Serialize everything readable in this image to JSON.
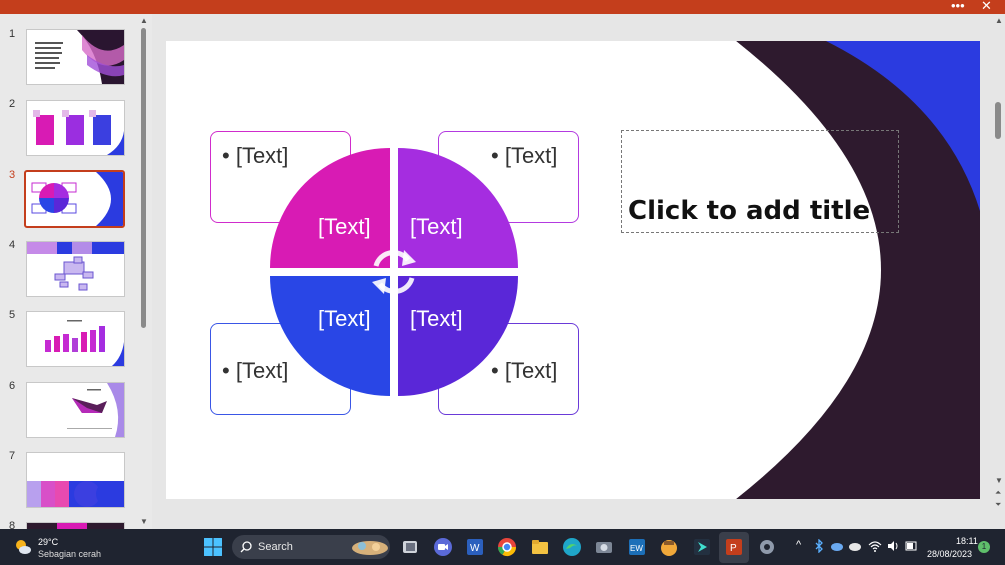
{
  "titlebar": {
    "more_glyph": "•••",
    "close_glyph": "✕"
  },
  "slides_panel": {
    "items": [
      {
        "num": "1"
      },
      {
        "num": "2"
      },
      {
        "num": "3"
      },
      {
        "num": "4"
      },
      {
        "num": "5"
      },
      {
        "num": "6"
      },
      {
        "num": "7"
      },
      {
        "num": "8"
      }
    ],
    "active_index": 3
  },
  "slide": {
    "title_placeholder": "Click to add title",
    "bullets": {
      "top_left": "[Text]",
      "top_right": "[Text]",
      "bottom_left": "[Text]",
      "bottom_right": "[Text]"
    },
    "quadrants": {
      "top_left": "[Text]",
      "top_right": "[Text]",
      "bottom_left": "[Text]",
      "bottom_right": "[Text]"
    }
  },
  "colors": {
    "accent": "#c43e1c",
    "magenta": "#d81bb4",
    "purple": "#a52de0",
    "blue": "#2946e6",
    "violet": "#5a27d8",
    "dark": "#2e1a2e",
    "bg_blue": "#2b3be0"
  },
  "taskbar": {
    "weather": {
      "temp": "29°C",
      "condition": "Sebagian cerah"
    },
    "search": {
      "label": "Search"
    },
    "apps": [
      "windows-start",
      "file-explorer",
      "zoom",
      "word",
      "chrome",
      "folder",
      "edge",
      "camera",
      "ew-app",
      "emoji-app",
      "arrow-app",
      "powerpoint",
      "settings"
    ],
    "clock": {
      "time": "18:11",
      "date": "28/08/2023"
    },
    "notification_count": "1"
  }
}
